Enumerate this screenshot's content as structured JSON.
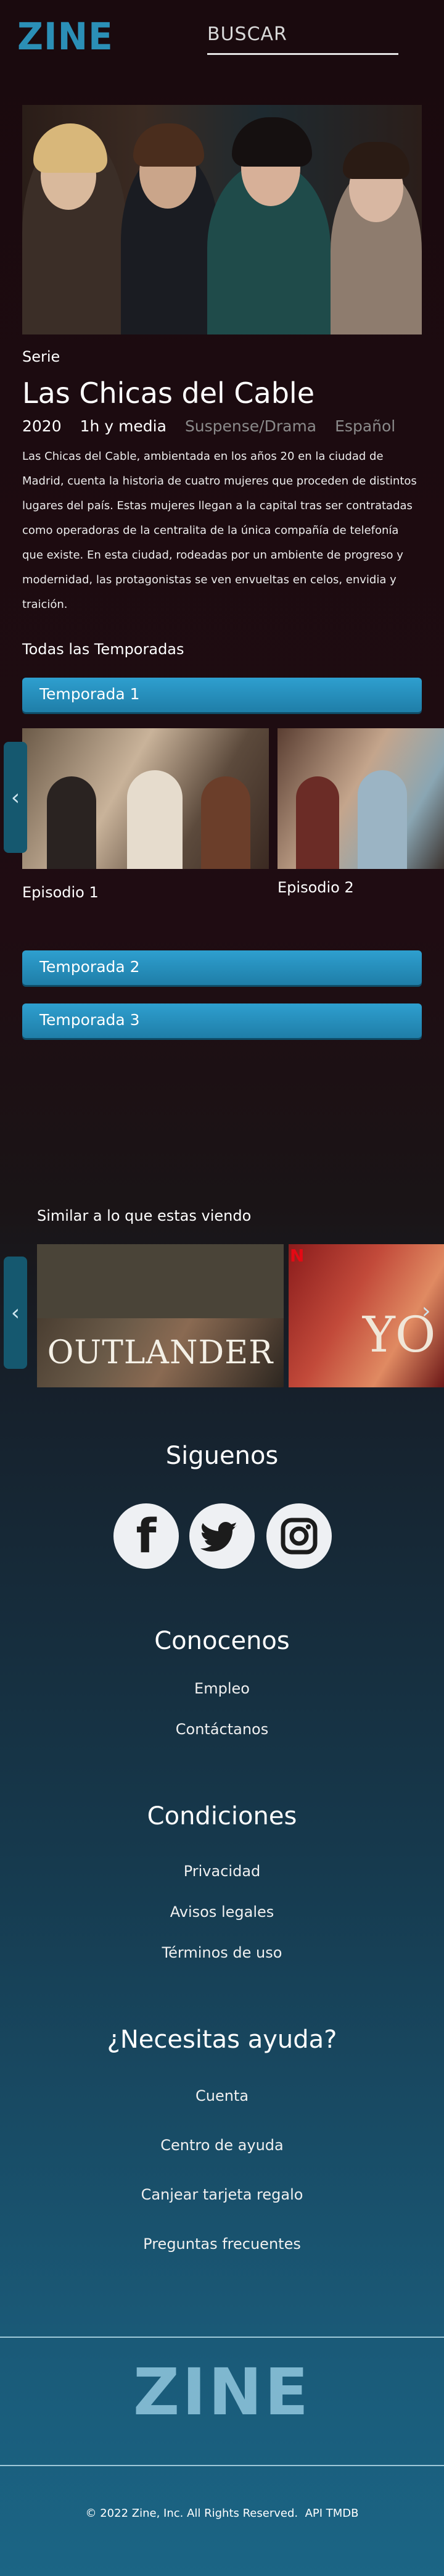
{
  "header": {
    "logo": "ZINE",
    "search_placeholder": "BUSCAR"
  },
  "show": {
    "type_label": "Serie",
    "title": "Las Chicas del Cable",
    "year": "2020",
    "duration": "1h y media",
    "genre": "Suspense/Drama",
    "language": "Español",
    "description": "Las Chicas del Cable, ambientada en los años 20 en la ciudad de Madrid, cuenta la historia de cuatro mujeres que proceden de distintos lugares del país. Estas mujeres llegan a la capital tras ser contratadas como operadoras de la centralita de la única compañía de telefonía que existe. En esta ciudad, rodeadas por un ambiente de progreso y modernidad, las protagonistas se ven envueltas en celos, envidia y traición."
  },
  "seasons": {
    "heading": "Todas las Temporadas",
    "items": [
      "Temporada 1",
      "Temporada 2",
      "Temporada 3"
    ],
    "episodes": [
      "Episodio 1",
      "Episodio 2"
    ]
  },
  "similar": {
    "heading": "Similar a lo que estas viendo",
    "items": [
      "OUTLANDER",
      "YO"
    ]
  },
  "footer": {
    "follow": "Siguenos",
    "about": {
      "title": "Conocenos",
      "links": [
        "Empleo",
        "Contáctanos"
      ]
    },
    "conditions": {
      "title": "Condiciones",
      "links": [
        "Privacidad",
        "Avisos legales",
        "Términos de uso"
      ]
    },
    "help": {
      "title": "¿Necesitas ayuda?",
      "links": [
        "Cuenta",
        "Centro de ayuda",
        "Canjear tarjeta regalo",
        "Preguntas frecuentes"
      ]
    },
    "logo": "ZINE",
    "copyright": "© 2022 Zine, Inc. All Rights Reserved.",
    "api": "API TMDB"
  },
  "colors": {
    "accent": "#2b8fb6",
    "button": "#2e9fcf"
  }
}
